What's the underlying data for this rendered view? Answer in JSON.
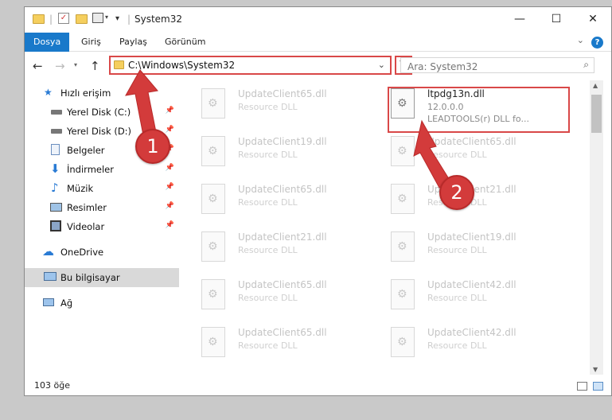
{
  "window": {
    "title": "System32",
    "controls": {
      "minimize": "—",
      "maximize": "☐",
      "close": "✕"
    }
  },
  "ribbon": {
    "tabs": [
      "Dosya",
      "Giriş",
      "Paylaş",
      "Görünüm"
    ],
    "help": "?"
  },
  "address": {
    "path": "C:\\Windows\\System32",
    "search_placeholder": "Ara: System32"
  },
  "nav": {
    "items": [
      {
        "label": "Hızlı erişim",
        "icon": "star-icon",
        "pinned": false
      },
      {
        "label": "Yerel Disk (C:)",
        "icon": "drive-icon",
        "pinned": true
      },
      {
        "label": "Yerel Disk (D:)",
        "icon": "drive-icon",
        "pinned": true
      },
      {
        "label": "Belgeler",
        "icon": "documents-icon",
        "pinned": true
      },
      {
        "label": "İndirmeler",
        "icon": "download-icon",
        "pinned": true
      },
      {
        "label": "Müzik",
        "icon": "music-icon",
        "pinned": true
      },
      {
        "label": "Resimler",
        "icon": "pictures-icon",
        "pinned": true
      },
      {
        "label": "Videolar",
        "icon": "video-icon",
        "pinned": true
      },
      {
        "label": "OneDrive",
        "icon": "cloud-icon",
        "pinned": false
      },
      {
        "label": "Bu bilgisayar",
        "icon": "computer-icon",
        "pinned": false,
        "selected": true
      },
      {
        "label": "Ağ",
        "icon": "network-icon",
        "pinned": false
      }
    ]
  },
  "files": {
    "highlighted": {
      "name": "ltpdg13n.dll",
      "version": "12.0.0.0",
      "description": "LEADTOOLS(r) DLL fo..."
    },
    "left_column": [
      {
        "name": "UpdateClient65.dll",
        "type": "Resource DLL"
      },
      {
        "name": "UpdateClient19.dll",
        "type": "Resource DLL"
      },
      {
        "name": "UpdateClient65.dll",
        "type": "Resource DLL"
      },
      {
        "name": "UpdateClient21.dll",
        "type": "Resource DLL"
      },
      {
        "name": "UpdateClient65.dll",
        "type": "Resource DLL"
      },
      {
        "name": "UpdateClient65.dll",
        "type": "Resource DLL"
      }
    ],
    "right_column": [
      {
        "name": "UpdateClient65.dll",
        "type": "Resource DLL"
      },
      {
        "name": "UpdateClient21.dll",
        "type": "Resource DLL"
      },
      {
        "name": "UpdateClient19.dll",
        "type": "Resource DLL"
      },
      {
        "name": "UpdateClient42.dll",
        "type": "Resource DLL"
      },
      {
        "name": "UpdateClient42.dll",
        "type": "Resource DLL"
      }
    ]
  },
  "status": {
    "count": "103 öğe"
  },
  "callouts": {
    "one": "1",
    "two": "2",
    "color": "#d33b3b"
  }
}
